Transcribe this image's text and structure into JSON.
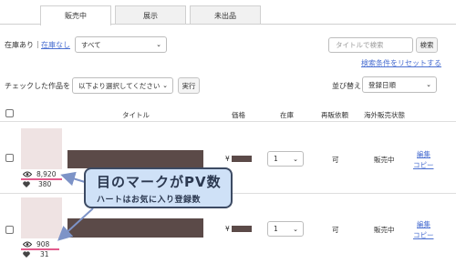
{
  "tabs": [
    {
      "label": "販売中",
      "active": true
    },
    {
      "label": "展示",
      "active": false
    },
    {
      "label": "未出品",
      "active": false
    }
  ],
  "filter": {
    "in_stock_label": "在庫あり",
    "separator": "|",
    "out_of_stock_label": "在庫なし",
    "category_select": "すべて",
    "search_placeholder": "タイトルで検索",
    "search_button": "検索",
    "reset_link": "検索条件をリセットする"
  },
  "bulk": {
    "label": "チェックした作品を",
    "action_select": "以下より選択してください",
    "execute_button": "実行",
    "sort_label": "並び替え",
    "sort_select": "登録日順"
  },
  "columns": {
    "title": "タイトル",
    "price": "価格",
    "stock": "在庫",
    "resale": "再販依頼",
    "overseas": "海外販売状態"
  },
  "rows": [
    {
      "views": "8,920",
      "likes": "380",
      "price_prefix": "¥",
      "stock": "1",
      "resale": "可",
      "overseas": "販売中",
      "edit": "編集",
      "copy": "コピー"
    },
    {
      "views": "908",
      "likes": "31",
      "price_prefix": "¥",
      "stock": "1",
      "resale": "可",
      "overseas": "販売中",
      "edit": "編集",
      "copy": "コピー"
    }
  ],
  "annotation": {
    "title": "目のマークがPV数",
    "subtitle": "ハートはお気に入り登録数",
    "colors": {
      "fill": "#cfe1f7",
      "border": "#3c4a63",
      "arrow": "#7d93c7",
      "underline": "#e25b8c"
    }
  },
  "icons": {
    "views": "eye-icon",
    "likes": "heart-icon",
    "dropdown": "chevron-down-icon"
  }
}
